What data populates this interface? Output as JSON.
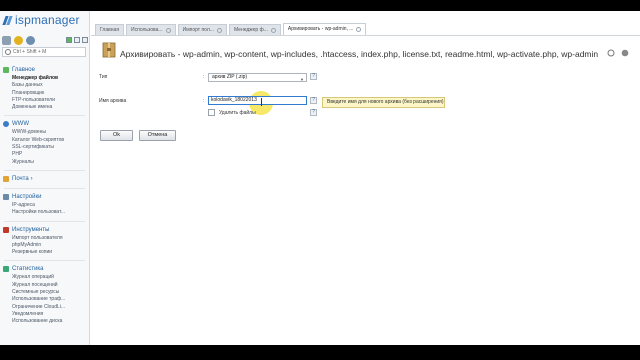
{
  "app": {
    "logo_text": "ispmanager"
  },
  "search": {
    "placeholder": "Ctrl + Shift + M"
  },
  "sidebar": {
    "groups": [
      {
        "title": "Главное",
        "icon": "home-icon",
        "items": [
          "Менеджер файлов",
          "Базы данных",
          "Планировщик",
          "FTP-пользователи",
          "Доменные имена"
        ]
      },
      {
        "title": "WWW",
        "icon": "globe-icon",
        "items": [
          "WWW-домены",
          "Каталог Web-скриптов",
          "SSL-сертификаты",
          "PHP",
          "Журналы"
        ]
      },
      {
        "title": "Почта",
        "icon": "mail-icon",
        "items": []
      },
      {
        "title": "Настройки",
        "icon": "settings-icon",
        "items": [
          "IP-адреса",
          "Настройки пользоват..."
        ]
      },
      {
        "title": "Инструменты",
        "icon": "tools-icon",
        "items": [
          "Импорт пользователя",
          "phpMyAdmin",
          "Резервные копии"
        ]
      },
      {
        "title": "Статистика",
        "icon": "stats-icon",
        "items": [
          "Журнал операций",
          "Журнал посещений",
          "Системные ресурсы",
          "Использование траф...",
          "Ограничение CloudLi...",
          "Уведомления",
          "Использование диска"
        ]
      }
    ],
    "mail_arrow": "›"
  },
  "tabs": [
    {
      "label": "Главная"
    },
    {
      "label": "Использова..."
    },
    {
      "label": "Импорт пол..."
    },
    {
      "label": "Менеджер ф..."
    },
    {
      "label": "Архивировать - wp-admin, ..."
    }
  ],
  "page": {
    "title": "Архивировать - wp-admin, wp-content, wp-includes, .htaccess, index.php, license.txt, readme.html, wp-activate.php, wp-admin.zi..."
  },
  "form": {
    "type_label": "Тип",
    "type_value": "архив ZIP (.zip)",
    "name_label": "Имя архива",
    "name_value": "kolodavik_18022013",
    "delete_label": "Удалить файлы",
    "help": "?",
    "tooltip": "Введите имя для нового архива (без расширения)"
  },
  "buttons": {
    "ok": "Ok",
    "cancel": "Отмена"
  },
  "colors": {
    "accent": "#1e5f9b",
    "tooltip_bg": "#fdf6c6",
    "highlight": "#f6e034"
  }
}
